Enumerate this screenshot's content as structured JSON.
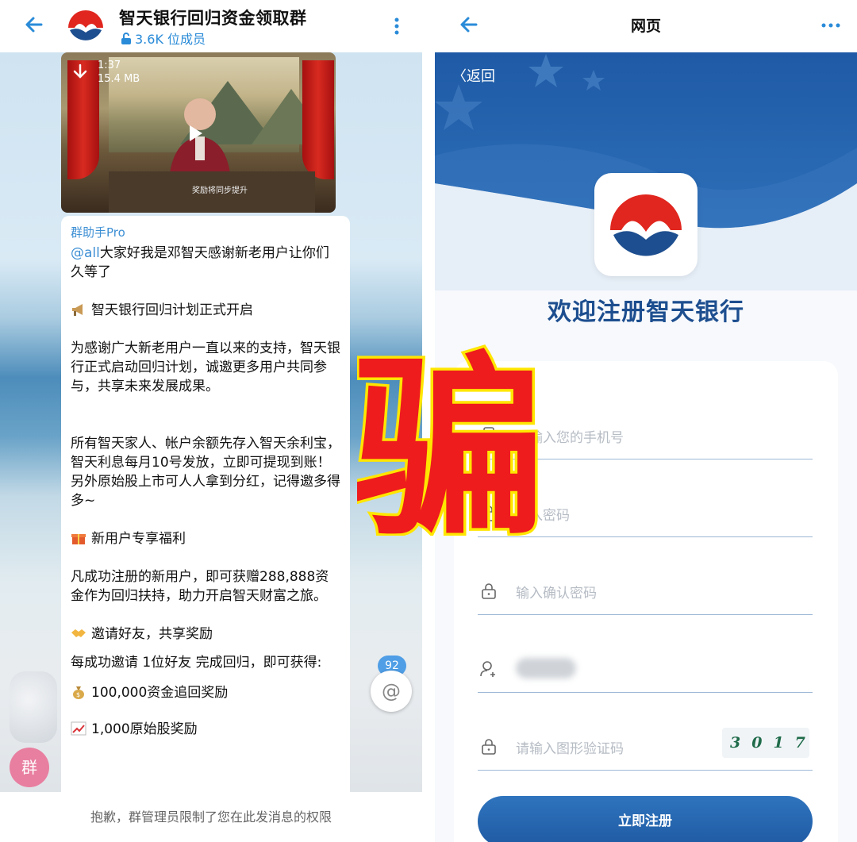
{
  "left": {
    "group_title": "智天银行回归资金领取群",
    "members": "3.6K 位成员",
    "video": {
      "duration": "1:37",
      "size": "15.4 MB",
      "caption": "奖励将同步提升"
    },
    "sender": "群助手Pro",
    "message": {
      "mention": "@all",
      "line1": "大家好我是邓智天感谢新老用户让你们久等了",
      "heading1": "智天银行回归计划正式开启",
      "para1": "为感谢广大新老用户一直以来的支持，智天银行正式启动回归计划，诚邀更多用户共同参与，共享未来发展成果。",
      "para2": "所有智天家人、帐户余额先存入智天余利宝，智天利息每月10号发放，立即可提现到账！另外原始股上市可人人拿到分红，记得邀多得多~",
      "heading2": "新用户专享福利",
      "para3": "凡成功注册的新用户，即可获赠288,888资金作为回归扶持，助力开启智天财富之旅。",
      "heading3": "邀请好友，共享奖励",
      "para4": "每成功邀请 1位好友 完成回归，即可获得:",
      "reward1": "100,000资金追回奖励",
      "reward2": "1,000原始股奖励"
    },
    "mention_count": "92",
    "mention_symbol": "@",
    "qun_label": "群",
    "restriction": "抱歉，群管理员限制了您在此发消息的权限"
  },
  "right": {
    "title": "网页",
    "back_label": "返回",
    "welcome": "欢迎注册智天银行",
    "fields": {
      "phone_placeholder": "请输入您的手机号",
      "password_placeholder": "输入密码",
      "confirm_placeholder": "输入确认密码",
      "captcha_placeholder": "请输入图形验证码",
      "captcha_code": "3017"
    },
    "register_label": "立即注册"
  },
  "overlay": {
    "text": "骗",
    "color": "#ee1c1c",
    "outline": "#ffe600"
  },
  "colors": {
    "brand_red": "#e0261e",
    "brand_blue": "#1d4e8f",
    "link_blue": "#3d8fd4"
  }
}
